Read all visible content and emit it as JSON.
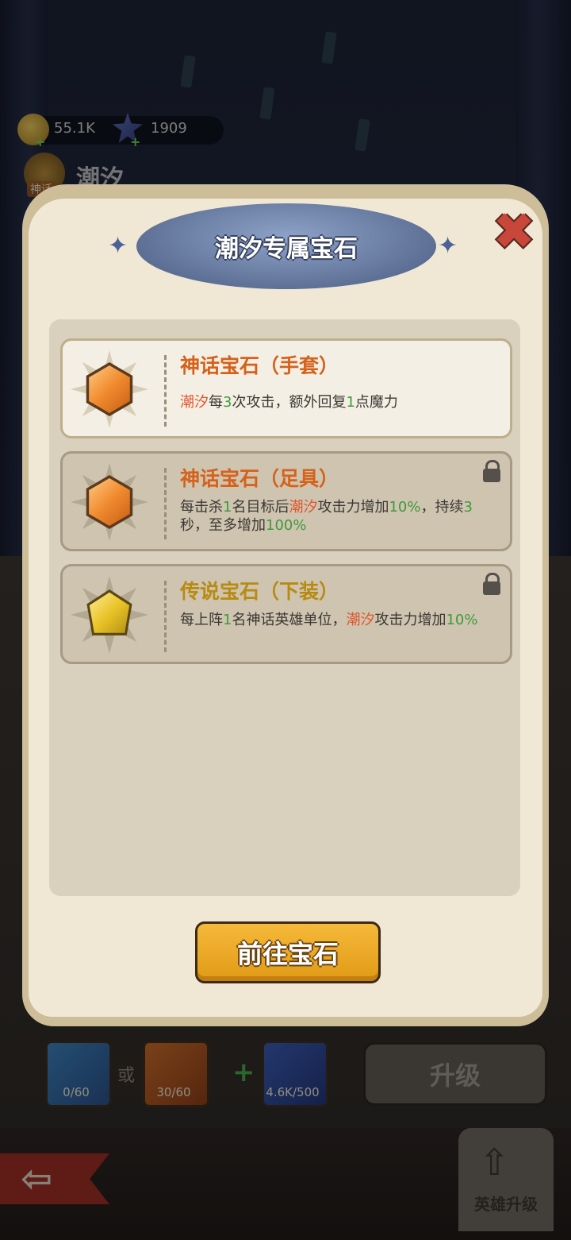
{
  "hud": {
    "gold": "55.1K",
    "stars": "1909",
    "hero_name": "潮汐",
    "hero_tier": "神话"
  },
  "background": {
    "or_text": "或",
    "materials": [
      {
        "count": "0/60"
      },
      {
        "count": "30/60"
      },
      {
        "count": "4.6K/500"
      }
    ],
    "upgrade_label": "升级",
    "hero_upgrade_label": "英雄升级"
  },
  "modal": {
    "title": "潮汐专属宝石",
    "gems": [
      {
        "title": "神话宝石（手套）",
        "locked": false,
        "desc": [
          {
            "t": "潮汐",
            "c": "red"
          },
          {
            "t": "每"
          },
          {
            "t": "3",
            "c": "green"
          },
          {
            "t": "次攻击，额外回复"
          },
          {
            "t": "1",
            "c": "green"
          },
          {
            "t": "点魔力"
          }
        ]
      },
      {
        "title": "神话宝石（足具）",
        "locked": true,
        "desc": [
          {
            "t": "每击杀"
          },
          {
            "t": "1",
            "c": "green"
          },
          {
            "t": "名目标后"
          },
          {
            "t": "潮汐",
            "c": "red"
          },
          {
            "t": "攻击力增加"
          },
          {
            "t": "10%",
            "c": "green"
          },
          {
            "t": "，持续"
          },
          {
            "t": "3",
            "c": "green"
          },
          {
            "t": "秒，至多增加"
          },
          {
            "t": "100%",
            "c": "green"
          }
        ]
      },
      {
        "title": "传说宝石（下装）",
        "locked": true,
        "desc": [
          {
            "t": "每上阵"
          },
          {
            "t": "1",
            "c": "green"
          },
          {
            "t": "名神话英雄单位，"
          },
          {
            "t": "潮汐",
            "c": "red"
          },
          {
            "t": "攻击力增加"
          },
          {
            "t": "10%",
            "c": "green"
          }
        ]
      }
    ],
    "go_button": "前往宝石"
  },
  "colors": {
    "orange_title": "#d5611a",
    "gold_title": "#b78b12",
    "highlight_red": "#e0552c",
    "highlight_green": "#3f9a3a",
    "button": "#f0a824"
  }
}
